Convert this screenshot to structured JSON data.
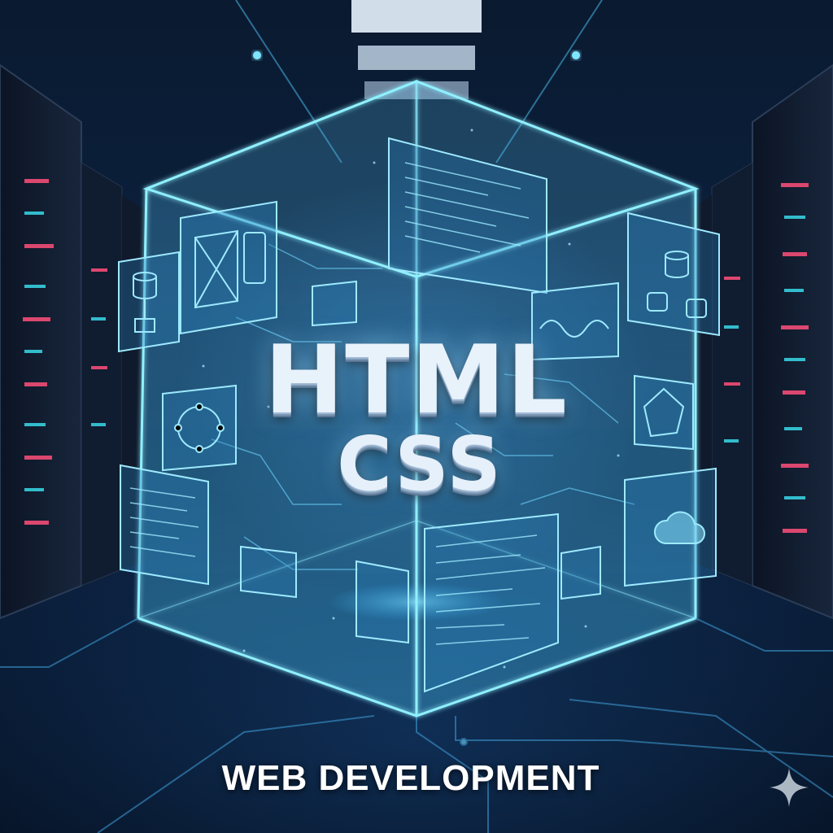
{
  "scene": {
    "headline": "HTML",
    "subheadline": "CSS",
    "caption": "WEB DEVELOPMENT",
    "colors": {
      "background": "#0a1d38",
      "hologram": "#7fe6ff",
      "server_led_red": "#ff4f7a",
      "server_led_cyan": "#39d9e8",
      "text": "#ffffff"
    },
    "icons": [
      "wireframe-layout-icon",
      "mobile-device-icon",
      "database-icon",
      "cloud-icon",
      "sparkle-icon"
    ]
  }
}
